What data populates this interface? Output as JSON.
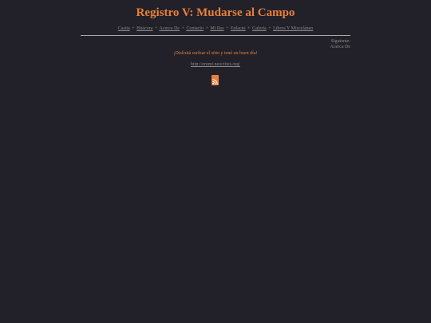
{
  "header": {
    "title": "Registro V: Mudarse al Campo"
  },
  "nav": {
    "items": [
      {
        "label": "Casita"
      },
      {
        "label": "Bitácora"
      },
      {
        "label": "Acerca De"
      },
      {
        "label": "Contacto"
      },
      {
        "label": "Mi Rss"
      },
      {
        "label": "Enlaces"
      },
      {
        "label": "Galería"
      },
      {
        "label": "Libros Y Misceláneo"
      }
    ],
    "separator": "+"
  },
  "pager": {
    "next_label": "Siguiente:",
    "next_link": "Acerca De"
  },
  "body": {
    "tagline": "¡Disfrutá surfear el sitio y tené un buen día!",
    "url": "http://emmi.neocities.org/"
  },
  "icons": {
    "feed": "rss-feed-icon"
  },
  "colors": {
    "background": "#222129",
    "accent": "#e8803b",
    "link": "#8a8a8a"
  }
}
